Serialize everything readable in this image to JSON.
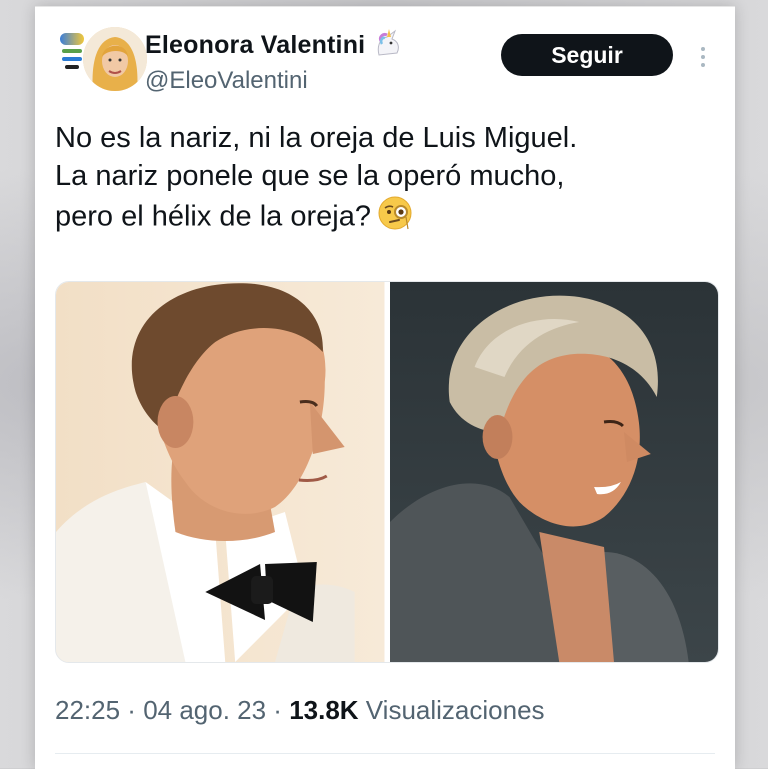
{
  "author": {
    "name": "Eleonora Valentini",
    "handle": "@EleoValentini",
    "name_emoji": "unicorn-emoji"
  },
  "actions": {
    "follow_label": "Seguir",
    "more_icon": "more-vertical-icon"
  },
  "tweet": {
    "lines": [
      "No es la nariz, ni la oreja de Luis Miguel.",
      "La nariz ponele que se la operó mucho,",
      "pero el hélix de la oreja?"
    ],
    "emoji": "face-with-monocle-emoji"
  },
  "media": {
    "images": [
      "photo-left-white-tuxedo-profile",
      "photo-right-grey-shirt-profile"
    ]
  },
  "meta": {
    "time": "22:25",
    "sep1": " · ",
    "date": "04 ago. 23",
    "sep2": " · ",
    "views_count": "13.8K",
    "views_label": " Visualizaciones"
  }
}
